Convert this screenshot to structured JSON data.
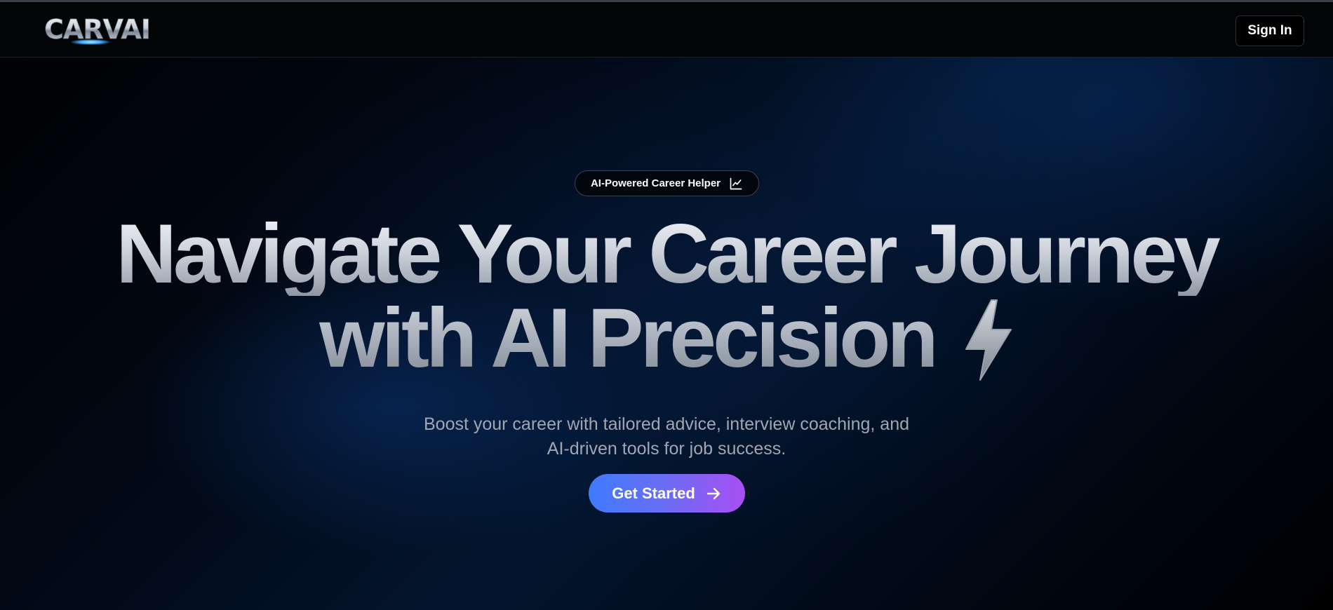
{
  "header": {
    "logo_text": "CARVAI",
    "signin_label": "Sign In"
  },
  "hero": {
    "badge_label": "AI-Powered Career Helper",
    "badge_icon": "line-chart-icon",
    "headline_line1": "Navigate Your Career Journey",
    "headline_line2": "with AI Precision",
    "headline_icon": "lightning-bolt-icon",
    "subtitle_line1": "Boost your career with tailored advice, interview coaching, and",
    "subtitle_line2": "AI-driven tools for job success.",
    "cta_label": "Get Started",
    "cta_icon": "arrow-right-icon"
  },
  "colors": {
    "background": "#000000",
    "accent_gradient_start": "#3e7bff",
    "accent_gradient_end": "#a94ef2",
    "subtitle_text": "#a1a7b1"
  }
}
